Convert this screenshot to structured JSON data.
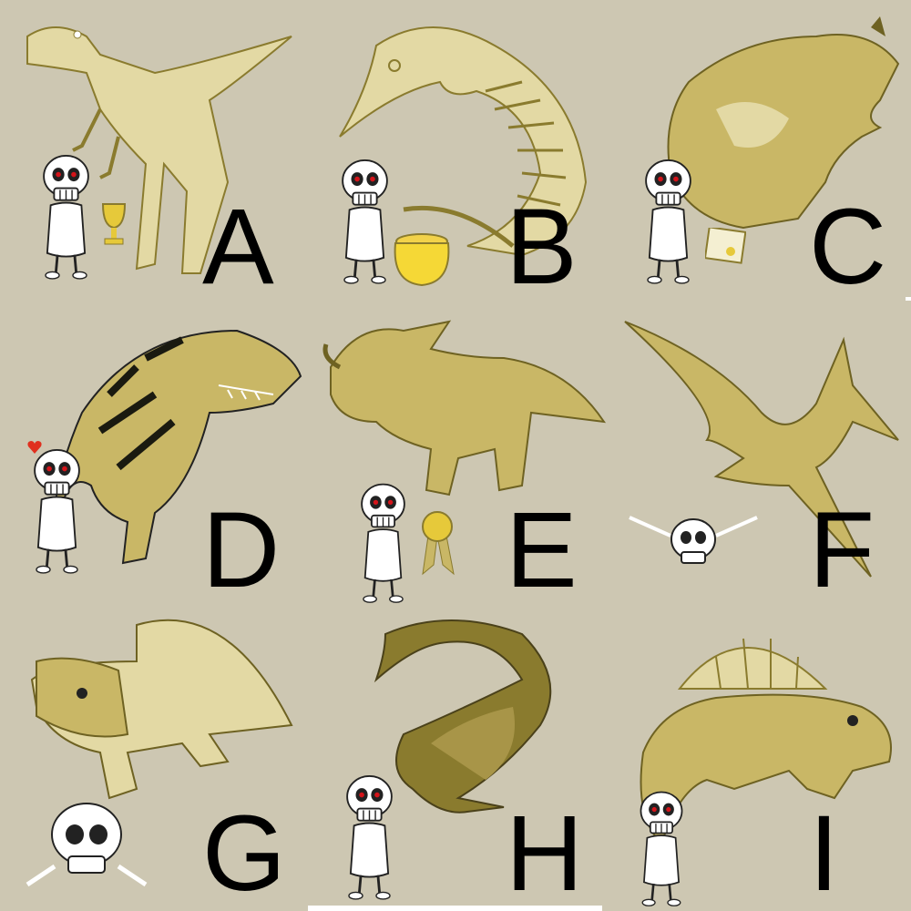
{
  "colors": {
    "background": "#cdc7b2",
    "gold_light": "#e3d9a4",
    "gold_mid": "#c9b766",
    "gold_dark": "#8a7b2e",
    "skeleton": "#ffffff",
    "eye": "#d4141a",
    "letter": "#000000"
  },
  "panels": [
    {
      "letter": "A",
      "creature_icon": "raptor-skeleton-icon",
      "prop_icon": "trophy-icon"
    },
    {
      "letter": "B",
      "creature_icon": "ichthyosaur-skeleton-icon",
      "prop_icon": "gold-pot-icon"
    },
    {
      "letter": "C",
      "creature_icon": "mammal-creature-icon",
      "prop_icon": "certificate-icon"
    },
    {
      "letter": "D",
      "creature_icon": "tyrannosaur-icon",
      "prop_icon": "heart-icon"
    },
    {
      "letter": "E",
      "creature_icon": "triceratops-icon",
      "prop_icon": "ribbon-icon"
    },
    {
      "letter": "F",
      "creature_icon": "pterosaur-icon",
      "prop_icon": "skull-icon"
    },
    {
      "letter": "G",
      "creature_icon": "glyptodont-icon",
      "prop_icon": "skull-icon"
    },
    {
      "letter": "H",
      "creature_icon": "long-neck-bird-icon",
      "prop_icon": "skeleton-icon"
    },
    {
      "letter": "I",
      "creature_icon": "dimetrodon-icon",
      "prop_icon": "skeleton-icon"
    }
  ]
}
